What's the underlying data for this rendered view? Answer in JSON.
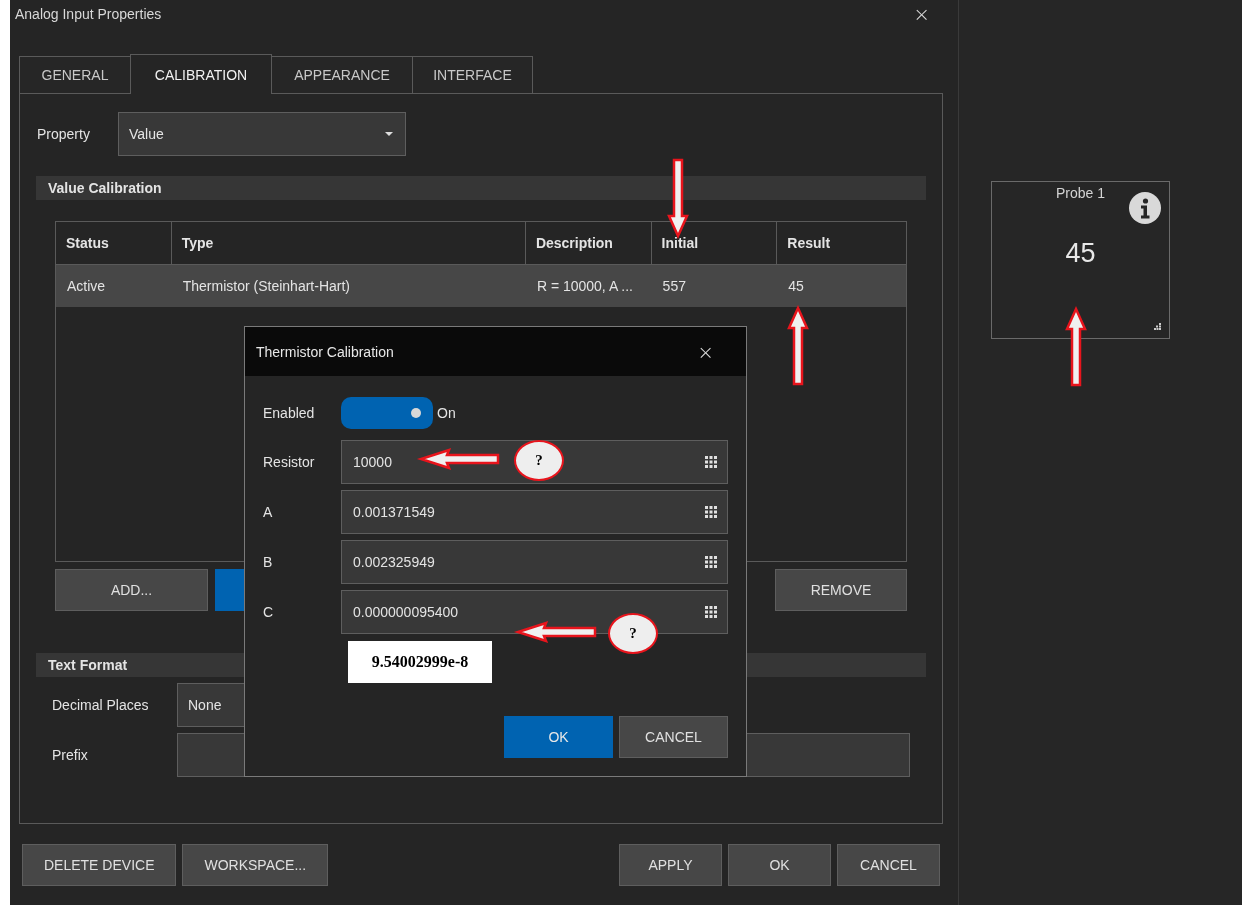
{
  "window": {
    "title": "Analog Input Properties",
    "close": "×"
  },
  "tabs": [
    {
      "label": "GENERAL",
      "selected": false
    },
    {
      "label": "CALIBRATION",
      "selected": true
    },
    {
      "label": "APPEARANCE",
      "selected": false
    },
    {
      "label": "INTERFACE",
      "selected": false
    }
  ],
  "property": {
    "label": "Property",
    "value": "Value"
  },
  "value_calibration": {
    "heading": "Value Calibration",
    "table": {
      "columns": [
        "Status",
        "Type",
        "Description",
        "Initial",
        "Result"
      ],
      "rows": [
        {
          "selected": true,
          "cells": [
            "Active",
            "Thermistor (Steinhart-Hart)",
            "R = 10000, A ...",
            "557",
            "45"
          ]
        }
      ]
    },
    "buttons": [
      {
        "kind": "text",
        "label": "ADD..."
      },
      {
        "kind": "blank"
      },
      {
        "kind": "text",
        "label": "REMOVE"
      }
    ]
  },
  "text_format": {
    "heading": "Text Format",
    "decimal_places": {
      "label": "Decimal Places",
      "value": "None"
    },
    "prefix": {
      "label": "Prefix"
    }
  },
  "footer_buttons": {
    "left": [
      "DELETE DEVICE",
      "WORKSPACE..."
    ],
    "right": [
      "APPLY",
      "OK",
      "CANCEL"
    ]
  },
  "probe": {
    "title": "Probe 1",
    "value": "45"
  },
  "calibration_dialog": {
    "title": "Thermistor Calibration",
    "close": "×",
    "enabled": {
      "label": "Enabled",
      "on": true,
      "state_label": "On"
    },
    "fields": [
      {
        "label": "Resistor",
        "value": "10000"
      },
      {
        "label": "A",
        "value": "0.001371549"
      },
      {
        "label": "B",
        "value": "0.002325949"
      },
      {
        "label": "C",
        "value": "0.000000095400"
      }
    ],
    "ok": "OK",
    "cancel": "CANCEL"
  },
  "annotations": {
    "arrows": [
      {
        "kind": "down"
      },
      {
        "kind": "up"
      },
      {
        "kind": "up"
      },
      {
        "kind": "left"
      },
      {
        "kind": "left"
      }
    ],
    "callouts": [
      {
        "text": "?"
      },
      {
        "text": "?"
      }
    ],
    "note": "9.54002999e-8"
  }
}
